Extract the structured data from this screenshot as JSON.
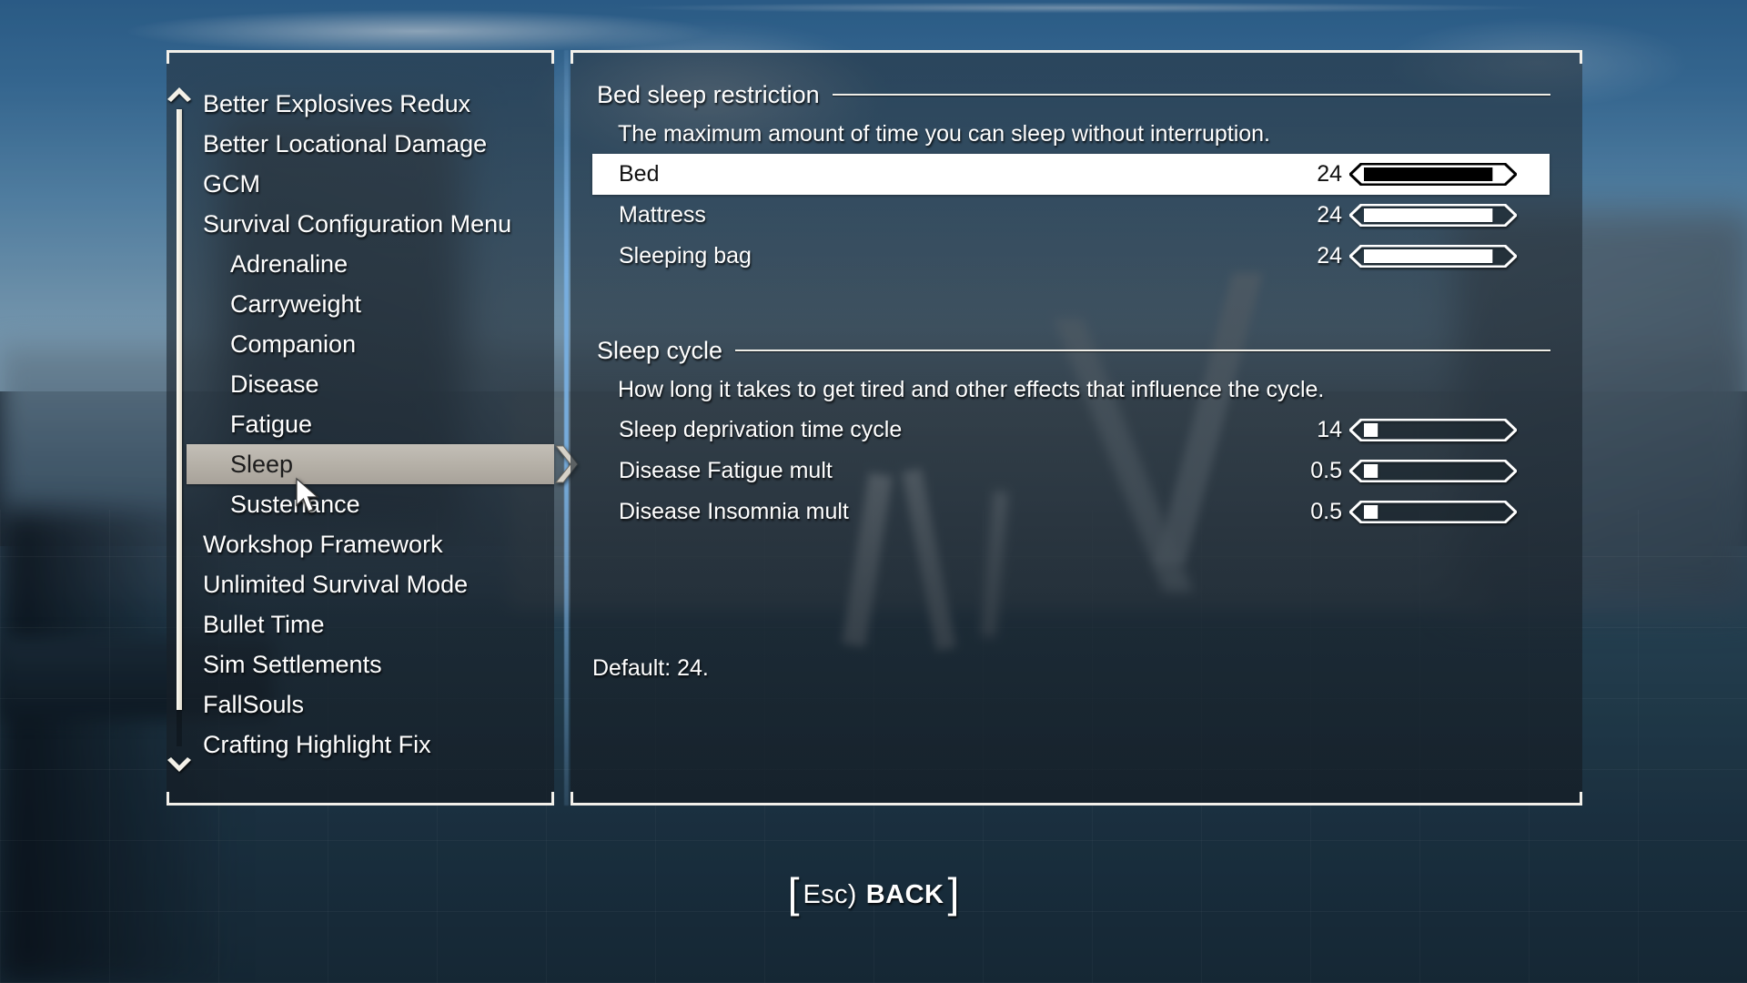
{
  "background": {
    "scene": "blurred-harbor-shipyard",
    "sky_color": "#5d90b5",
    "water_color": "#24404f"
  },
  "theme": {
    "text_color": "#ffffff",
    "frame_color": "#f2f0ea",
    "selected_row_bg": "#ffffff",
    "selected_nav_bg": "#b4afa6",
    "divider_accent": "#78afdb"
  },
  "sidebar": {
    "scroll_up_icon": "chevron-up-icon",
    "scroll_down_icon": "chevron-down-icon",
    "selected_index": 9,
    "items": [
      {
        "label": "Better Explosives Redux",
        "indent": 0,
        "selected": false
      },
      {
        "label": "Better Locational Damage",
        "indent": 0,
        "selected": false
      },
      {
        "label": "GCM",
        "indent": 0,
        "selected": false
      },
      {
        "label": "Survival Configuration Menu",
        "indent": 0,
        "selected": false
      },
      {
        "label": "Adrenaline",
        "indent": 1,
        "selected": false
      },
      {
        "label": "Carryweight",
        "indent": 1,
        "selected": false
      },
      {
        "label": "Companion",
        "indent": 1,
        "selected": false
      },
      {
        "label": "Disease",
        "indent": 1,
        "selected": false
      },
      {
        "label": "Fatigue",
        "indent": 1,
        "selected": false
      },
      {
        "label": "Sleep",
        "indent": 1,
        "selected": true
      },
      {
        "label": "Sustenance",
        "indent": 1,
        "selected": false
      },
      {
        "label": "Workshop Framework",
        "indent": 0,
        "selected": false
      },
      {
        "label": "Unlimited Survival Mode",
        "indent": 0,
        "selected": false
      },
      {
        "label": "Bullet Time",
        "indent": 0,
        "selected": false
      },
      {
        "label": "Sim Settlements",
        "indent": 0,
        "selected": false
      },
      {
        "label": "FallSouls",
        "indent": 0,
        "selected": false
      },
      {
        "label": "Crafting Highlight Fix",
        "indent": 0,
        "selected": false
      }
    ]
  },
  "main": {
    "sections": [
      {
        "title": "Bed sleep restriction",
        "description": "The maximum amount of time you can sleep without interruption.",
        "settings": [
          {
            "label": "Bed",
            "value": "24",
            "fill": 0.93,
            "selected": true
          },
          {
            "label": "Mattress",
            "value": "24",
            "fill": 0.93,
            "selected": false
          },
          {
            "label": "Sleeping bag",
            "value": "24",
            "fill": 0.93,
            "selected": false
          }
        ]
      },
      {
        "title": "Sleep cycle",
        "description": "How long it takes to get tired and other effects that influence the cycle.",
        "settings": [
          {
            "label": "Sleep deprivation time cycle",
            "value": "14",
            "fill": 0.1,
            "selected": false
          },
          {
            "label": "Disease Fatigue mult",
            "value": "0.5",
            "fill": 0.1,
            "selected": false
          },
          {
            "label": "Disease Insomnia mult",
            "value": "0.5",
            "fill": 0.1,
            "selected": false
          }
        ]
      }
    ],
    "default_note": "Default: 24."
  },
  "footer": {
    "open_bracket": "[",
    "key": "Esc)",
    "label": "BACK",
    "close_bracket": "]"
  }
}
